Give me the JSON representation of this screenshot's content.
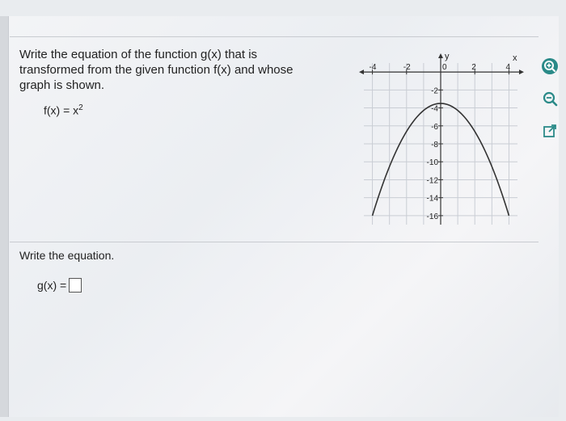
{
  "question": {
    "text": "Write the equation of the function g(x) that is transformed from the given function f(x) and whose graph is shown.",
    "given_label": "f(x) = x",
    "given_exponent": "2"
  },
  "answer": {
    "prompt": "Write the equation.",
    "label": "g(x) =",
    "value": ""
  },
  "chart_data": {
    "type": "line",
    "xlabel": "x",
    "ylabel": "y",
    "xlim": [
      -4.5,
      4.5
    ],
    "ylim": [
      -17,
      1
    ],
    "x_ticks": [
      -4,
      -2,
      2,
      4
    ],
    "y_ticks": [
      -2,
      -4,
      -6,
      -8,
      -10,
      -12,
      -14,
      -16
    ],
    "series": [
      {
        "x": [
          -4,
          -3,
          -2,
          -1,
          0,
          1,
          2,
          3,
          4
        ],
        "y": [
          -16,
          -9.25,
          -4.25,
          -3.25,
          -4,
          -3.25,
          -4.25,
          -9.25,
          -16
        ],
        "smooth": true
      }
    ],
    "curve": {
      "vertex": [
        0,
        -3.5
      ],
      "points": [
        [
          -4,
          -16
        ],
        [
          -3,
          -10.25
        ],
        [
          -2,
          -6
        ],
        [
          -1,
          -4.25
        ],
        [
          0,
          -3.5
        ],
        [
          1,
          -4.25
        ],
        [
          2,
          -6
        ],
        [
          3,
          -10.25
        ],
        [
          4,
          -16
        ]
      ]
    },
    "grid": true
  },
  "tools": {
    "zoom_in": "zoom-in-icon",
    "zoom_out": "zoom-out-icon",
    "popout": "popout-icon"
  },
  "colors": {
    "grid": "#c9cdd4",
    "axis": "#333333",
    "curve": "#333333",
    "icon": "#2a8a88"
  }
}
